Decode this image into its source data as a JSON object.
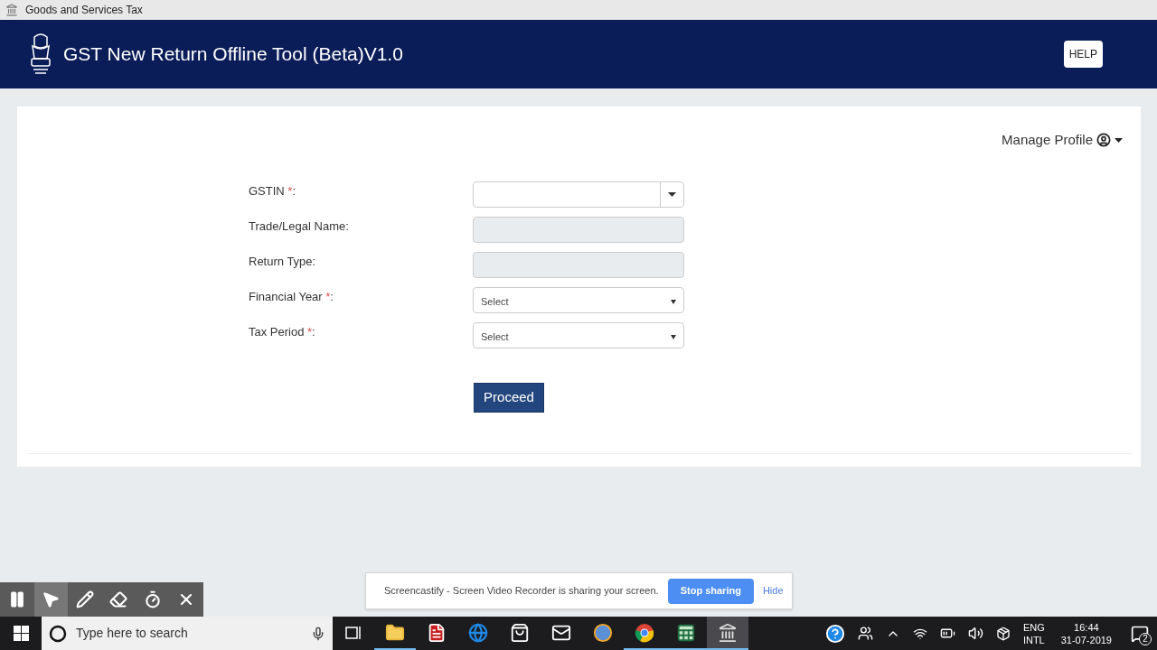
{
  "window": {
    "title": "Goods and Services Tax"
  },
  "header": {
    "title": "GST New Return Offline Tool (Beta)V1.0",
    "help_button": "HELP"
  },
  "manage_profile": {
    "label": "Manage Profile"
  },
  "form": {
    "fields": [
      {
        "kind": "combo",
        "label": "GSTIN",
        "required_mark": "*",
        "label_end": ":",
        "disabled": false
      },
      {
        "kind": "text",
        "label": "Trade/Legal Name:",
        "disabled": true
      },
      {
        "kind": "text",
        "label": "Return Type:",
        "disabled": true
      },
      {
        "kind": "select",
        "label": "Financial Year",
        "required_mark": "*",
        "label_end": ":",
        "value": "Select",
        "disabled": false
      },
      {
        "kind": "select",
        "label": "Tax Period",
        "required_mark": "*",
        "label_end": ":",
        "value": "Select",
        "disabled": false
      }
    ],
    "button": "Proceed"
  },
  "recorder_toolbar": {
    "tools": [
      {
        "kind": "pause",
        "selected": false
      },
      {
        "kind": "pointer",
        "selected": true
      },
      {
        "kind": "pen",
        "selected": false
      },
      {
        "kind": "eraser",
        "selected": false
      },
      {
        "kind": "timer",
        "selected": false
      },
      {
        "kind": "close",
        "selected": false
      }
    ]
  },
  "sharing_bar": {
    "message": "Screencastify - Screen Video Recorder is sharing your screen.",
    "stop_button": "Stop sharing",
    "hide_link": "Hide"
  },
  "taskbar": {
    "search_placeholder": "Type here to search",
    "apps": [
      {
        "kind": "task-view",
        "open": false,
        "selected": false
      },
      {
        "kind": "explorer",
        "open": true,
        "selected": false
      },
      {
        "kind": "acrobat",
        "open": false,
        "selected": false
      },
      {
        "kind": "edge",
        "open": false,
        "selected": false
      },
      {
        "kind": "store",
        "open": false,
        "selected": false
      },
      {
        "kind": "mail",
        "open": false,
        "selected": false
      },
      {
        "kind": "media",
        "open": false,
        "selected": false
      },
      {
        "kind": "chrome",
        "open": true,
        "selected": false
      },
      {
        "kind": "excel",
        "open": true,
        "selected": false
      },
      {
        "kind": "gst-app",
        "open": true,
        "selected": true
      }
    ],
    "language": [
      "ENG",
      "INTL"
    ],
    "time": "16:44",
    "date": "31-07-2019",
    "notification_count": "2"
  }
}
